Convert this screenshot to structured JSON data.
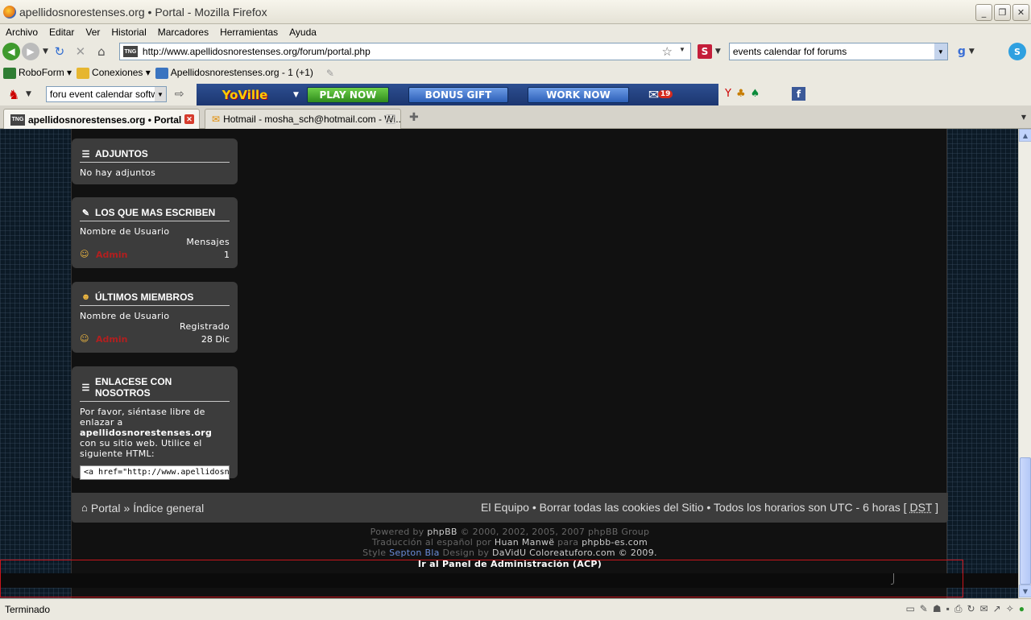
{
  "window": {
    "title": "apellidosnorestenses.org • Portal - Mozilla Firefox",
    "min": "_",
    "max": "❐",
    "close": "✕"
  },
  "menu": [
    "Archivo",
    "Editar",
    "Ver",
    "Historial",
    "Marcadores",
    "Herramientas",
    "Ayuda"
  ],
  "nav": {
    "url": "http://www.apellidosnorestenses.org/forum/portal.php",
    "search_value": "events calendar fof forums"
  },
  "bookmarks": {
    "roboform": "RoboForm",
    "conexiones": "Conexiones",
    "site": "Apellidosnorestenses.org - 1 (+1)"
  },
  "yoville": {
    "search_value": "foru event calendar softw",
    "logo": "YoVille",
    "play": "PLAY NOW",
    "bonus": "BONUS GIFT",
    "work": "WORK NOW",
    "mail_count": "19"
  },
  "tabs": [
    {
      "label": "apellidosnorestenses.org • Portal"
    },
    {
      "label": "Hotmail - mosha_sch@hotmail.com - Wi..."
    }
  ],
  "blocks": {
    "adjuntos": {
      "title": "ADJUNTOS",
      "text": "No hay adjuntos"
    },
    "escriben": {
      "title": "LOS QUE MAS ESCRIBEN",
      "col1": "Nombre de Usuario",
      "col2": "Mensajes",
      "user": "Admin",
      "value": "1"
    },
    "miembros": {
      "title": "ÚLTIMOS MIEMBROS",
      "col1": "Nombre de Usuario",
      "col2": "Registrado",
      "user": "Admin",
      "value": "28 Dic"
    },
    "enlace": {
      "title": "ENLACESE CON NOSOTROS",
      "text1": "Por favor, siéntase libre de enlazar a",
      "site": "apellidosnorestenses.org",
      "text2": "con su sitio web. Utilice el siguiente HTML:",
      "code": "<a href=\"http://www.apellidosnorestenses.org\">"
    }
  },
  "footer": {
    "portal": "Portal",
    "sep": "»",
    "index": "Índice general",
    "right_team": "El Equipo",
    "right_cookies": "Borrar todas las cookies del Sitio",
    "right_times": "Todos los horarios son UTC - 6 horas [",
    "dst": "DST",
    "bracket": "]",
    "bullet": "•"
  },
  "credits": {
    "l1a": "Powered by",
    "l1b": "phpBB",
    "l1c": "© 2000, 2002, 2005, 2007 phpBB Group",
    "l2a": "Traducción al español por",
    "l2b": "Huan Manwë",
    "l2c": "para",
    "l2d": "phpbb-es.com",
    "l3a": "Style",
    "l3b": "Septon Bla",
    "l3c": "Design by",
    "l3d": "DaVidU",
    "l3e": "Coloreatuforo.com © 2009.",
    "acp": "Ir al Panel de Administración (ACP)"
  },
  "status": {
    "text": "Terminado"
  }
}
